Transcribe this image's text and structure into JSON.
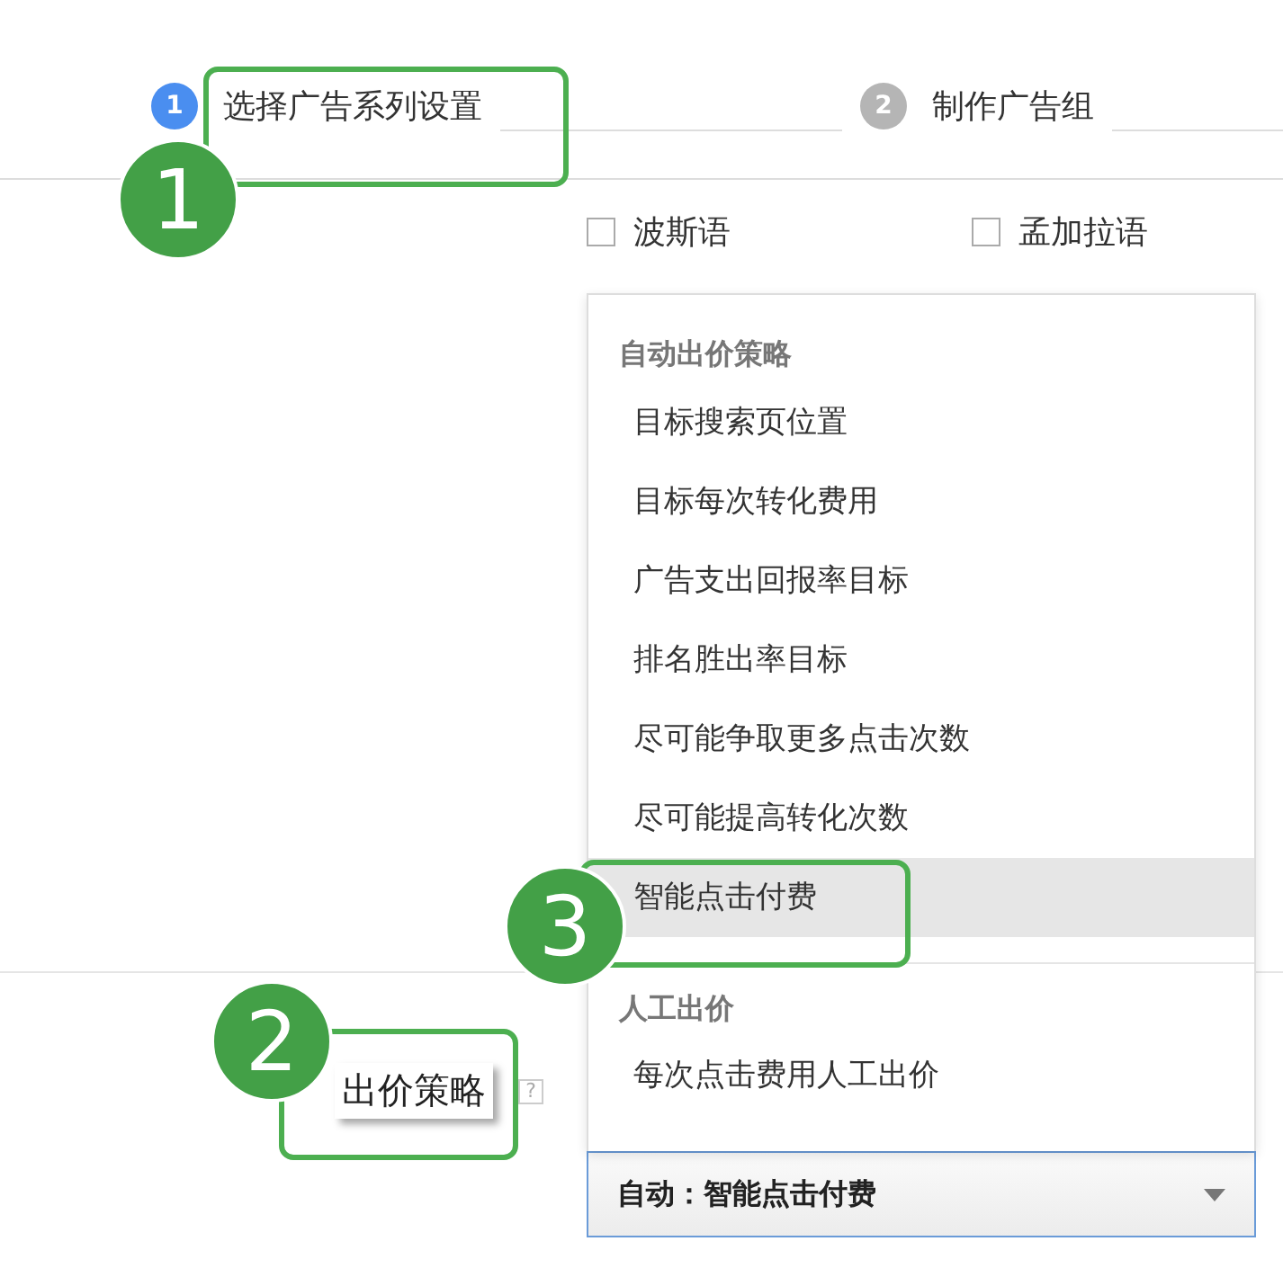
{
  "steps": [
    {
      "number": "1",
      "label": "选择广告系列设置",
      "selected": true
    },
    {
      "number": "2",
      "label": "制作广告组",
      "selected": false
    }
  ],
  "languages": [
    {
      "label": "波斯语",
      "checked": false
    },
    {
      "label": "孟加拉语",
      "checked": false
    }
  ],
  "bid_strategy": {
    "label": "出价策略",
    "help": "?",
    "value": "自动：智能点击付费"
  },
  "menu": {
    "groups": [
      {
        "heading": "自动出价策略",
        "items": [
          {
            "label": "目标搜索页位置",
            "selected": false
          },
          {
            "label": "目标每次转化费用",
            "selected": false
          },
          {
            "label": "广告支出回报率目标",
            "selected": false
          },
          {
            "label": "排名胜出率目标",
            "selected": false
          },
          {
            "label": "尽可能争取更多点击次数",
            "selected": false
          },
          {
            "label": "尽可能提高转化次数",
            "selected": false
          },
          {
            "label": "智能点击付费",
            "selected": true
          }
        ]
      },
      {
        "heading": "人工出价",
        "items": [
          {
            "label": "每次点击费用人工出价",
            "selected": false
          }
        ]
      }
    ]
  },
  "annotations": [
    {
      "number": "1"
    },
    {
      "number": "2"
    },
    {
      "number": "3"
    }
  ]
}
